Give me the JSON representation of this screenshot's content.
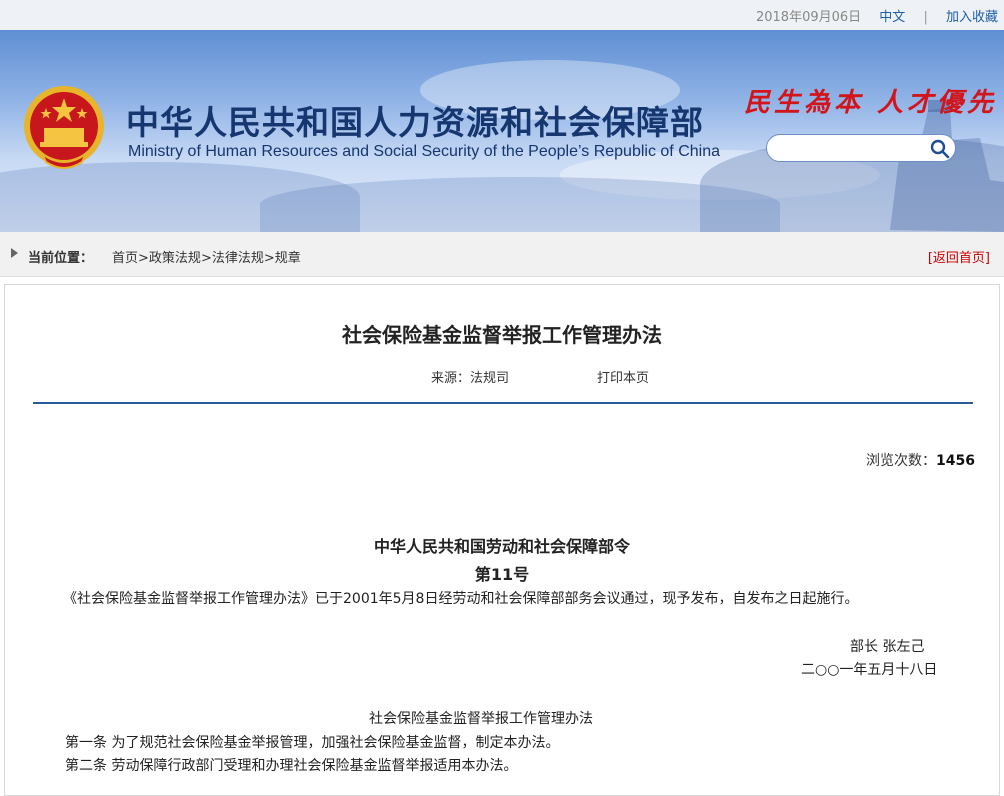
{
  "topbar": {
    "date": "2018年09月06日",
    "lang": "中文",
    "separator": "|",
    "favorite": "加入收藏"
  },
  "header": {
    "title_cn": "中华人民共和国人力资源和社会保障部",
    "title_en": "Ministry of Human Resources and Social Security of the People’s Republic of China",
    "slogan": "民生為本 人才優先",
    "search_placeholder": "",
    "emblem_icon": "national-emblem-icon",
    "search_icon": "search-icon"
  },
  "location": {
    "label": "当前位置：",
    "crumbs": [
      "首页",
      "政策法规",
      "法律法规",
      "规章"
    ],
    "sep": ">",
    "back": "[返回首页]"
  },
  "article": {
    "title": "社会保险基金监督举报工作管理办法",
    "source": "来源：法规司",
    "print": "打印本页",
    "views_label": "浏览次数：",
    "views_count": "1456",
    "order_title": "中华人民共和国劳动和社会保障部令",
    "order_no": "第11号",
    "intro": "《社会保险基金监督举报工作管理办法》已于2001年5月8日经劳动和社会保障部部务会议通过，现予发布，自发布之日起施行。",
    "signer": "部长  张左己",
    "sign_date": "二○○一年五月十八日",
    "doc_heading": "社会保险基金监督举报工作管理办法",
    "article1": "第一条  为了规范社会保险基金举报管理，加强社会保险基金监督，制定本办法。",
    "article2": "第二条  劳动保障行政部门受理和办理社会保险基金监督举报适用本办法。"
  },
  "colors": {
    "title_blue": "#16366f",
    "slogan_red": "#d2141b",
    "rule_blue": "#2a5c9a",
    "link_blue": "#1d5fa7"
  }
}
